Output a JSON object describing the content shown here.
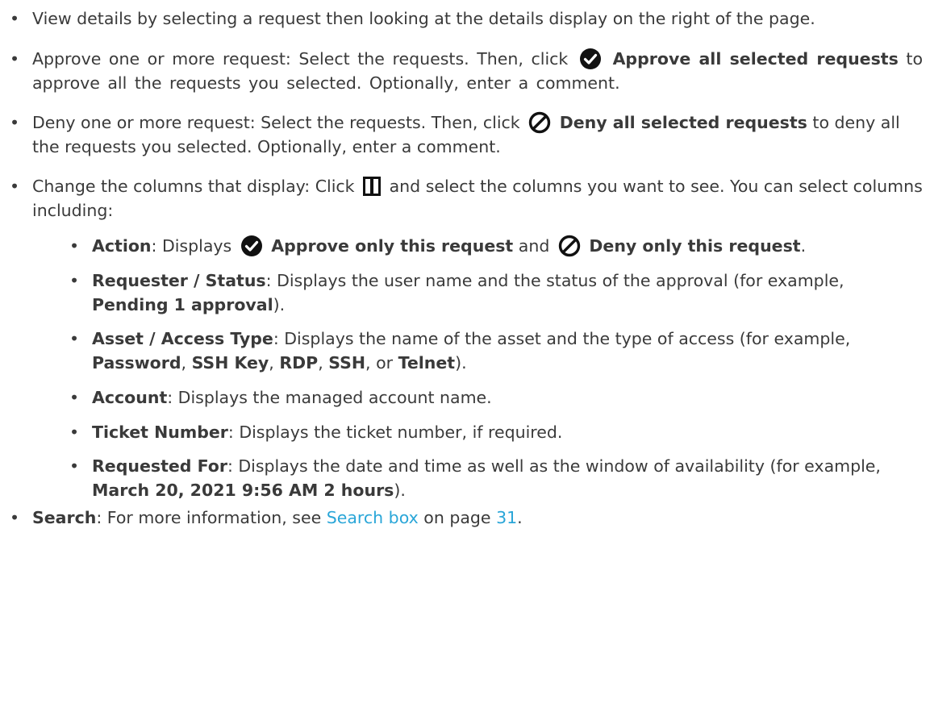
{
  "bullet_char": "•",
  "items": {
    "view": {
      "text": "View details by selecting a request then looking at the details display on the right of the page."
    },
    "approve": {
      "lead": "Approve one or more request: Select the requests. Then, click",
      "bold": "Approve all selected requests",
      "tail": "to approve all the requests you selected. Optionally, enter a comment.",
      "icon": "check-circle-icon"
    },
    "deny": {
      "lead": "Deny one or more request: Select the requests. Then, click",
      "bold": "Deny all selected requests",
      "tail": "to deny all the requests you selected. Optionally, enter a comment.",
      "icon": "deny-circle-icon"
    },
    "columns": {
      "lead": "Change the columns that display: Click",
      "tail": "and select the columns you want to see. You can select columns including:",
      "icon": "columns-icon",
      "sub": {
        "action": {
          "label": "Action",
          "text1": ": Displays",
          "bold1": "Approve only this request",
          "text2": "and",
          "bold2": "Deny only this request",
          "text3": "."
        },
        "requester": {
          "label": "Requester / Status",
          "text1": ": Displays the user name and the status of the approval (for example,",
          "bold1": "Pending 1 approval",
          "text2": ")."
        },
        "asset": {
          "label": "Asset / Access Type",
          "text1": ": Displays the name of the asset and the type of access (for example,",
          "t_password": "Password",
          "t_sshkey": "SSH Key",
          "t_rdp": "RDP",
          "t_ssh": "SSH",
          "t_telnet": "Telnet",
          "sep": ",",
          "or": "or",
          "end": ")."
        },
        "account": {
          "label": "Account",
          "text1": ": Displays the managed account name."
        },
        "ticket": {
          "label": "Ticket Number",
          "text1": ": Displays the ticket number, if required."
        },
        "requested": {
          "label": "Requested For",
          "text1": ": Displays the date and time as well as the window of availability (for example,",
          "bold1": "March 20, 2021 9:56 AM 2 hours",
          "text2": ")."
        }
      }
    },
    "search": {
      "label": "Search",
      "text1": ": For more information, see",
      "link": "Search box",
      "text2": "on page",
      "page": "31",
      "text3": "."
    }
  },
  "colors": {
    "text": "#3a3a3a",
    "link": "#2aa6d8",
    "icon": "#111111"
  }
}
